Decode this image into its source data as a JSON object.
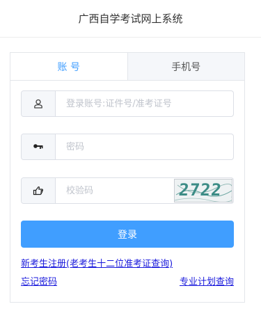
{
  "header": {
    "title": "广西自学考试网上系统"
  },
  "tabs": [
    {
      "label": "账 号",
      "active": true
    },
    {
      "label": "手机号",
      "active": false
    }
  ],
  "form": {
    "account_placeholder": "登录账号:证件号/准考证号",
    "password_placeholder": "密码",
    "captcha_placeholder": "校验码",
    "captcha_code": "2722",
    "login_label": "登录"
  },
  "links": {
    "register": "新考生注册(老考生十二位准考证查询)",
    "forgot_password": "忘记密码",
    "major_plan": "专业计划查询"
  },
  "colors": {
    "accent": "#409eff",
    "link": "#1a1adc"
  },
  "icons": {
    "account": "user-icon",
    "password": "key-icon",
    "captcha": "hand-pointer-icon"
  }
}
